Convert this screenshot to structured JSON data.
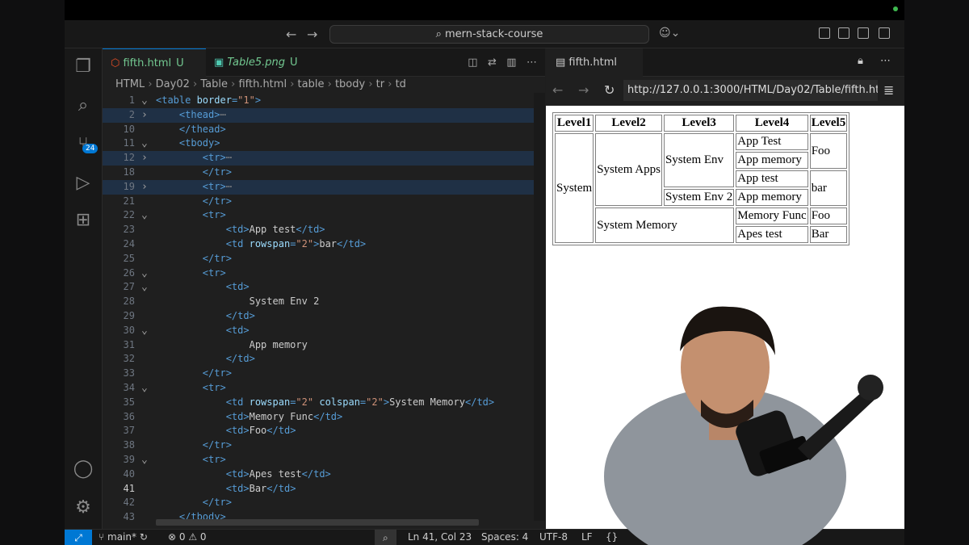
{
  "titlebar": {
    "search": "mern-stack-course"
  },
  "activity": {
    "scm_badge": "24"
  },
  "editor": {
    "tabs": [
      {
        "label": "fifth.html",
        "status": "U",
        "icon": "html5-icon"
      },
      {
        "label": "Table5.png",
        "status": "U",
        "icon": "image-icon"
      }
    ],
    "breadcrumb": [
      "HTML",
      "Day02",
      "Table",
      "fifth.html",
      "table",
      "tbody",
      "tr",
      "td"
    ],
    "lines": [
      {
        "n": "1",
        "fold": "v",
        "indent": "",
        "parts": [
          [
            "tg",
            "<table "
          ],
          [
            "at",
            "border"
          ],
          [
            "tg",
            "="
          ],
          [
            "st",
            "\"1\""
          ],
          [
            "tg",
            ">"
          ]
        ]
      },
      {
        "n": "2",
        "fold": ">",
        "indent": "    ",
        "hl": true,
        "parts": [
          [
            "tg",
            "<thead>"
          ],
          [
            "ell",
            "⋯"
          ]
        ]
      },
      {
        "n": "10",
        "fold": "",
        "indent": "    ",
        "parts": [
          [
            "tg",
            "</thead>"
          ]
        ]
      },
      {
        "n": "11",
        "fold": "v",
        "indent": "    ",
        "parts": [
          [
            "tg",
            "<tbody>"
          ]
        ]
      },
      {
        "n": "12",
        "fold": ">",
        "indent": "        ",
        "hl": true,
        "parts": [
          [
            "tg",
            "<tr>"
          ],
          [
            "ell",
            "⋯"
          ]
        ]
      },
      {
        "n": "18",
        "fold": "",
        "indent": "        ",
        "parts": [
          [
            "tg",
            "</tr>"
          ]
        ]
      },
      {
        "n": "19",
        "fold": ">",
        "indent": "        ",
        "hl": true,
        "parts": [
          [
            "tg",
            "<tr>"
          ],
          [
            "ell",
            "⋯"
          ]
        ]
      },
      {
        "n": "21",
        "fold": "",
        "indent": "        ",
        "parts": [
          [
            "tg",
            "</tr>"
          ]
        ]
      },
      {
        "n": "22",
        "fold": "v",
        "indent": "        ",
        "parts": [
          [
            "tg",
            "<tr>"
          ]
        ]
      },
      {
        "n": "23",
        "fold": "",
        "indent": "            ",
        "parts": [
          [
            "tg",
            "<td>"
          ],
          [
            "tx",
            "App test"
          ],
          [
            "tg",
            "</td>"
          ]
        ]
      },
      {
        "n": "24",
        "fold": "",
        "indent": "            ",
        "parts": [
          [
            "tg",
            "<td "
          ],
          [
            "at",
            "rowspan"
          ],
          [
            "tg",
            "="
          ],
          [
            "st",
            "\"2\""
          ],
          [
            "tg",
            ">"
          ],
          [
            "tx",
            "bar"
          ],
          [
            "tg",
            "</td>"
          ]
        ]
      },
      {
        "n": "25",
        "fold": "",
        "indent": "        ",
        "parts": [
          [
            "tg",
            "</tr>"
          ]
        ]
      },
      {
        "n": "26",
        "fold": "v",
        "indent": "        ",
        "parts": [
          [
            "tg",
            "<tr>"
          ]
        ]
      },
      {
        "n": "27",
        "fold": "v",
        "indent": "            ",
        "parts": [
          [
            "tg",
            "<td>"
          ]
        ]
      },
      {
        "n": "28",
        "fold": "",
        "indent": "                ",
        "parts": [
          [
            "tx",
            "System Env 2"
          ]
        ]
      },
      {
        "n": "29",
        "fold": "",
        "indent": "            ",
        "parts": [
          [
            "tg",
            "</td>"
          ]
        ]
      },
      {
        "n": "30",
        "fold": "v",
        "indent": "            ",
        "parts": [
          [
            "tg",
            "<td>"
          ]
        ]
      },
      {
        "n": "31",
        "fold": "",
        "indent": "                ",
        "parts": [
          [
            "tx",
            "App memory"
          ]
        ]
      },
      {
        "n": "32",
        "fold": "",
        "indent": "            ",
        "parts": [
          [
            "tg",
            "</td>"
          ]
        ]
      },
      {
        "n": "33",
        "fold": "",
        "indent": "        ",
        "parts": [
          [
            "tg",
            "</tr>"
          ]
        ]
      },
      {
        "n": "34",
        "fold": "v",
        "indent": "        ",
        "parts": [
          [
            "tg",
            "<tr>"
          ]
        ]
      },
      {
        "n": "35",
        "fold": "",
        "indent": "            ",
        "parts": [
          [
            "tg",
            "<td "
          ],
          [
            "at",
            "rowspan"
          ],
          [
            "tg",
            "="
          ],
          [
            "st",
            "\"2\""
          ],
          [
            "tx",
            " "
          ],
          [
            "at",
            "colspan"
          ],
          [
            "tg",
            "="
          ],
          [
            "st",
            "\"2\""
          ],
          [
            "tg",
            ">"
          ],
          [
            "tx",
            "System Memory"
          ],
          [
            "tg",
            "</td>"
          ]
        ]
      },
      {
        "n": "36",
        "fold": "",
        "indent": "            ",
        "parts": [
          [
            "tg",
            "<td>"
          ],
          [
            "tx",
            "Memory Func"
          ],
          [
            "tg",
            "</td>"
          ]
        ]
      },
      {
        "n": "37",
        "fold": "",
        "indent": "            ",
        "parts": [
          [
            "tg",
            "<td>"
          ],
          [
            "tx",
            "Foo"
          ],
          [
            "tg",
            "</td>"
          ]
        ]
      },
      {
        "n": "38",
        "fold": "",
        "indent": "        ",
        "parts": [
          [
            "tg",
            "</tr>"
          ]
        ]
      },
      {
        "n": "39",
        "fold": "v",
        "indent": "        ",
        "parts": [
          [
            "tg",
            "<tr>"
          ]
        ]
      },
      {
        "n": "40",
        "fold": "",
        "indent": "            ",
        "parts": [
          [
            "tg",
            "<td>"
          ],
          [
            "tx",
            "Apes test"
          ],
          [
            "tg",
            "</td>"
          ]
        ]
      },
      {
        "n": "41",
        "fold": "",
        "indent": "            ",
        "cur": true,
        "parts": [
          [
            "tg",
            "<td>"
          ],
          [
            "tx",
            "Bar"
          ],
          [
            "tg",
            "</td>"
          ]
        ]
      },
      {
        "n": "42",
        "fold": "",
        "indent": "        ",
        "parts": [
          [
            "tg",
            "</tr>"
          ]
        ]
      },
      {
        "n": "43",
        "fold": "",
        "indent": "    ",
        "parts": [
          [
            "tg",
            "</tbody>"
          ]
        ]
      }
    ]
  },
  "preview": {
    "tab_label": "fifth.html",
    "url": "http://127.0.0.1:3000/HTML/Day02/Table/fifth.html",
    "table": {
      "headers": [
        "Level1",
        "Level2",
        "Level3",
        "Level4",
        "Level5"
      ],
      "system": "System",
      "system_apps": "System Apps",
      "system_env": "System Env",
      "system_env2": "System Env 2",
      "system_memory": "System Memory",
      "app_test_1": "App Test",
      "app_memory_1": "App memory",
      "app_test_2": "App test",
      "app_memory_2": "App memory",
      "memory_func": "Memory Func",
      "apes_test": "Apes test",
      "foo_1": "Foo",
      "bar_1": "bar",
      "foo_2": "Foo",
      "bar_2": "Bar"
    }
  },
  "statusbar": {
    "branch": "main*",
    "errors": "0",
    "warnings": "0",
    "position": "Ln 41, Col 23",
    "spaces": "Spaces: 4",
    "encoding": "UTF-8",
    "eol": "LF"
  },
  "colors": {
    "accent": "#0078d4",
    "untracked": "#73c991",
    "tag": "#569cd6",
    "attr": "#9cdcfe",
    "string": "#ce9178"
  }
}
